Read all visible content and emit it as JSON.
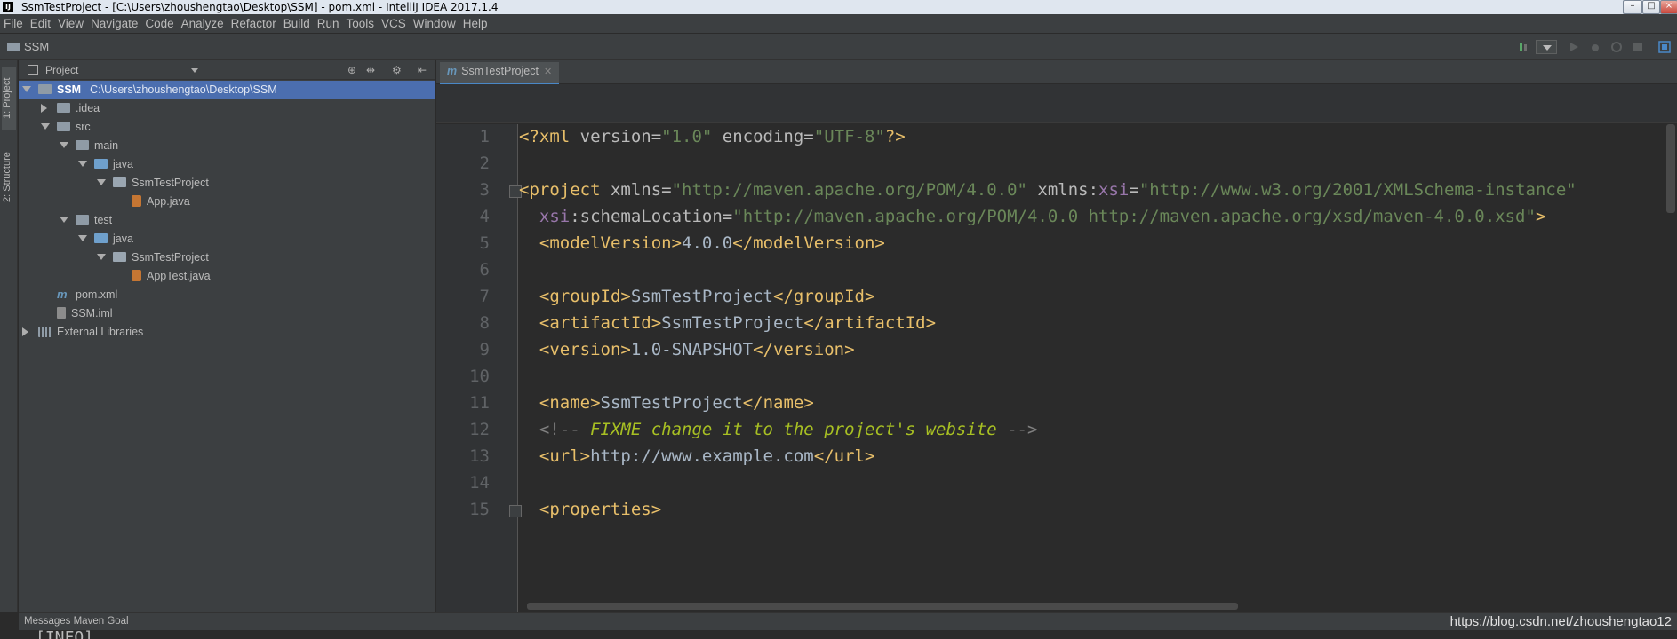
{
  "window": {
    "logo": "IJ",
    "title": "SsmTestProject - [C:\\Users\\zhoushengtao\\Desktop\\SSM] - pom.xml - IntelliJ IDEA 2017.1.4"
  },
  "menu": [
    "File",
    "Edit",
    "View",
    "Navigate",
    "Code",
    "Analyze",
    "Refactor",
    "Build",
    "Run",
    "Tools",
    "VCS",
    "Window",
    "Help"
  ],
  "navbar": {
    "crumb": "SSM"
  },
  "left_stripe": {
    "project_tab": "1: Project",
    "structure_tab": "2: Structure"
  },
  "project_panel": {
    "header_label": "Project",
    "tree": [
      {
        "label": "SSM",
        "path": "C:\\Users\\zhoushengtao\\Desktop\\SSM",
        "icon": "folder",
        "depth": 0,
        "expanded": true,
        "selected": true
      },
      {
        "label": ".idea",
        "icon": "folder",
        "depth": 1,
        "expanded": false
      },
      {
        "label": "src",
        "icon": "folder",
        "depth": 1,
        "expanded": true
      },
      {
        "label": "main",
        "icon": "folder",
        "depth": 2,
        "expanded": true
      },
      {
        "label": "java",
        "icon": "src",
        "depth": 3,
        "expanded": true
      },
      {
        "label": "SsmTestProject",
        "icon": "pkg",
        "depth": 4,
        "expanded": true
      },
      {
        "label": "App.java",
        "icon": "java",
        "depth": 5
      },
      {
        "label": "test",
        "icon": "folder",
        "depth": 2,
        "expanded": true
      },
      {
        "label": "java",
        "icon": "src",
        "depth": 3,
        "expanded": true
      },
      {
        "label": "SsmTestProject",
        "icon": "pkg",
        "depth": 4,
        "expanded": true
      },
      {
        "label": "AppTest.java",
        "icon": "java",
        "depth": 5
      },
      {
        "label": "pom.xml",
        "icon": "xml",
        "depth": 1
      },
      {
        "label": "SSM.iml",
        "icon": "iml",
        "depth": 1
      },
      {
        "label": "External Libraries",
        "icon": "lib",
        "depth": 0,
        "expanded": false
      }
    ]
  },
  "editor": {
    "tab_label": "SsmTestProject",
    "tab_icon": "m",
    "lines": [
      {
        "n": "1",
        "html": [
          [
            "tag",
            "<?xml "
          ],
          [
            "attr",
            "version="
          ],
          [
            "val",
            "\"1.0\""
          ],
          [
            "attr",
            " encoding="
          ],
          [
            "val",
            "\"UTF-8\""
          ],
          [
            "tag",
            "?>"
          ]
        ]
      },
      {
        "n": "2",
        "html": []
      },
      {
        "n": "3",
        "fold": true,
        "html": [
          [
            "tag",
            "<project "
          ],
          [
            "attr",
            "xmlns="
          ],
          [
            "val",
            "\"http://maven.apache.org/POM/4.0.0\""
          ],
          [
            "attr",
            " xmlns:"
          ],
          [
            "ns",
            "xsi"
          ],
          [
            "attr",
            "="
          ],
          [
            "val",
            "\"http://www.w3.org/2001/XMLSchema-instance\""
          ]
        ]
      },
      {
        "n": "4",
        "html": [
          [
            "txt",
            "  "
          ],
          [
            "ns",
            "xsi"
          ],
          [
            "attr",
            ":schemaLocation="
          ],
          [
            "val",
            "\"http://maven.apache.org/POM/4.0.0 http://maven.apache.org/xsd/maven-4.0.0.xsd\""
          ],
          [
            "tag",
            ">"
          ]
        ]
      },
      {
        "n": "5",
        "html": [
          [
            "txt",
            "  "
          ],
          [
            "tag",
            "<modelVersion>"
          ],
          [
            "txt",
            "4.0.0"
          ],
          [
            "tag",
            "</modelVersion>"
          ]
        ]
      },
      {
        "n": "6",
        "html": []
      },
      {
        "n": "7",
        "html": [
          [
            "txt",
            "  "
          ],
          [
            "tag",
            "<groupId>"
          ],
          [
            "txt",
            "SsmTestProject"
          ],
          [
            "tag",
            "</groupId>"
          ]
        ]
      },
      {
        "n": "8",
        "html": [
          [
            "txt",
            "  "
          ],
          [
            "tag",
            "<artifactId>"
          ],
          [
            "txt",
            "SsmTestProject"
          ],
          [
            "tag",
            "</artifactId>"
          ]
        ]
      },
      {
        "n": "9",
        "html": [
          [
            "txt",
            "  "
          ],
          [
            "tag",
            "<version>"
          ],
          [
            "txt",
            "1.0-SNAPSHOT"
          ],
          [
            "tag",
            "</version>"
          ]
        ]
      },
      {
        "n": "10",
        "html": []
      },
      {
        "n": "11",
        "html": [
          [
            "txt",
            "  "
          ],
          [
            "tag",
            "<name>"
          ],
          [
            "txt",
            "SsmTestProject"
          ],
          [
            "tag",
            "</name>"
          ]
        ]
      },
      {
        "n": "12",
        "html": [
          [
            "txt",
            "  "
          ],
          [
            "cmt",
            "<!-- "
          ],
          [
            "todo",
            "FIXME change it to the project's website"
          ],
          [
            "cmt",
            " -->"
          ]
        ]
      },
      {
        "n": "13",
        "html": [
          [
            "txt",
            "  "
          ],
          [
            "tag",
            "<url>"
          ],
          [
            "txt",
            "http://www.example.com"
          ],
          [
            "tag",
            "</url>"
          ]
        ]
      },
      {
        "n": "14",
        "html": []
      },
      {
        "n": "15",
        "fold": true,
        "html": [
          [
            "txt",
            "  "
          ],
          [
            "tag",
            "<properties>"
          ]
        ]
      }
    ]
  },
  "bottom": {
    "messages_label": "Messages Maven Goal",
    "watermark": "https://blog.csdn.net/zhoushengtao12",
    "console_text": "[INFO]"
  },
  "colors": {
    "accent": "#4b6eaf",
    "tag": "#e8bf6a",
    "string": "#6a8759",
    "namespace": "#9876aa",
    "todo": "#a8c023"
  }
}
